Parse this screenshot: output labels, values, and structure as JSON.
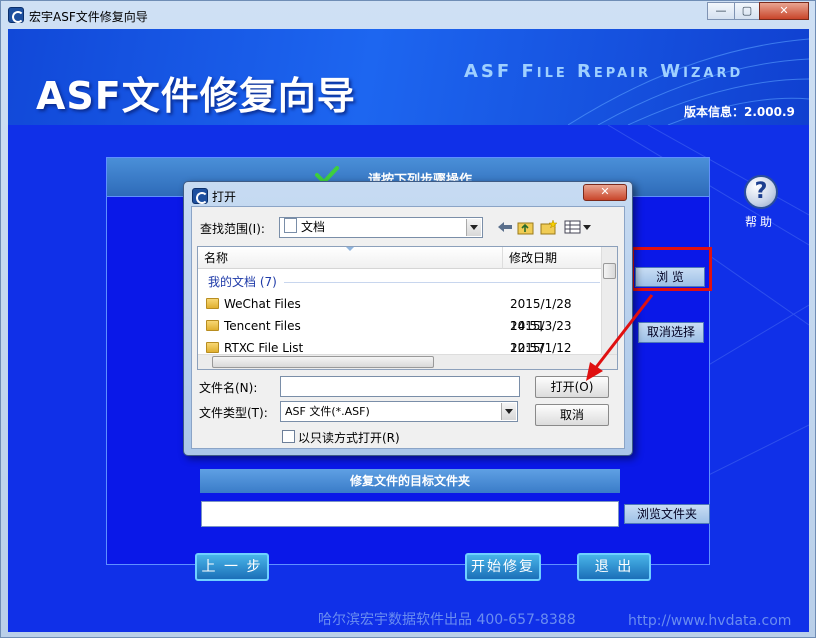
{
  "window": {
    "title": "宏宇ASF文件修复向导",
    "min_label": "—",
    "max_label": "▢",
    "close_label": "✕"
  },
  "banner": {
    "title": "ASF文件修复向导",
    "subtitle": "ASF File Repair Wizard",
    "version": "版本信息：2.000.9"
  },
  "panel": {
    "title": "请按下列步骤操作"
  },
  "help": {
    "glyph": "?",
    "label": "帮助"
  },
  "buttons": {
    "browse": "浏 览",
    "cancel_select": "取消选择",
    "browse_folder": "浏览文件夹",
    "prev": "上 一 步",
    "start": "开始修复",
    "exit": "退 出"
  },
  "target": {
    "heading": "修复文件的目标文件夹",
    "value": ""
  },
  "footer": {
    "company": "哈尔滨宏宇数据软件出品  400-657-8388",
    "url": "http://www.hvdata.com"
  },
  "dialog": {
    "title": "打开",
    "close_label": "✕",
    "look_in_label": "查找范围(I):",
    "look_in_value": "文档",
    "columns": [
      "名称",
      "修改日期"
    ],
    "group_label": "我的文档 (7)",
    "rows": [
      {
        "name": "WeChat Files",
        "date": "2015/1/28 14:51"
      },
      {
        "name": "Tencent Files",
        "date": "2015/3/23 12:57"
      },
      {
        "name": "RTXC File List",
        "date": "2015/1/12 8:57"
      }
    ],
    "filename_label": "文件名(N):",
    "filename_value": "",
    "filetype_label": "文件类型(T):",
    "filetype_value": "ASF 文件(*.ASF)",
    "open_button": "打开(O)",
    "cancel_button": "取消",
    "readonly_label": "以只读方式打开(R)"
  },
  "colors": {
    "client_blue": "#1030e8",
    "annotation_red": "#e01010"
  }
}
